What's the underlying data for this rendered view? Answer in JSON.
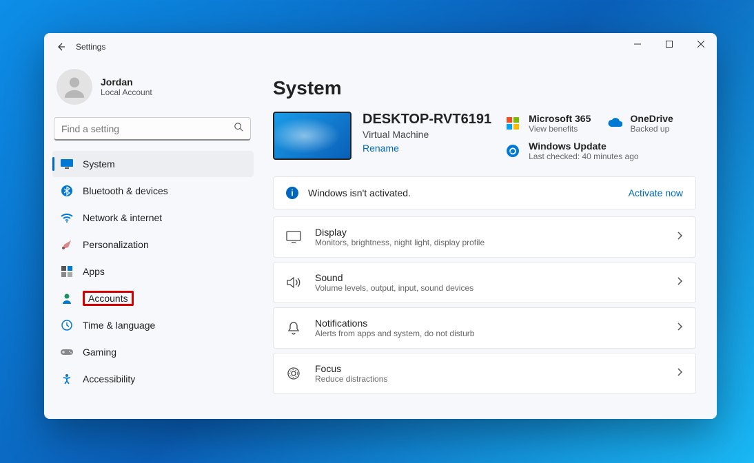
{
  "titlebar": {
    "title": "Settings"
  },
  "profile": {
    "name": "Jordan",
    "sub": "Local Account"
  },
  "search": {
    "placeholder": "Find a setting"
  },
  "nav": {
    "items": [
      {
        "label": "System",
        "icon": "monitor-icon",
        "active": true
      },
      {
        "label": "Bluetooth & devices",
        "icon": "bluetooth-icon"
      },
      {
        "label": "Network & internet",
        "icon": "wifi-icon"
      },
      {
        "label": "Personalization",
        "icon": "brush-icon"
      },
      {
        "label": "Apps",
        "icon": "apps-icon"
      },
      {
        "label": "Accounts",
        "icon": "person-icon",
        "highlight": true
      },
      {
        "label": "Time & language",
        "icon": "clock-icon"
      },
      {
        "label": "Gaming",
        "icon": "gamepad-icon"
      },
      {
        "label": "Accessibility",
        "icon": "accessibility-icon"
      }
    ]
  },
  "page": {
    "title": "System"
  },
  "pc": {
    "name": "DESKTOP-RVT6191",
    "type": "Virtual Machine",
    "rename": "Rename"
  },
  "cards": {
    "ms365": {
      "title": "Microsoft 365",
      "sub": "View benefits"
    },
    "onedrive": {
      "title": "OneDrive",
      "sub": "Backed up"
    },
    "update": {
      "title": "Windows Update",
      "sub": "Last checked: 40 minutes ago"
    }
  },
  "banner": {
    "text": "Windows isn't activated.",
    "action": "Activate now"
  },
  "rows": [
    {
      "title": "Display",
      "sub": "Monitors, brightness, night light, display profile",
      "icon": "display-icon"
    },
    {
      "title": "Sound",
      "sub": "Volume levels, output, input, sound devices",
      "icon": "sound-icon"
    },
    {
      "title": "Notifications",
      "sub": "Alerts from apps and system, do not disturb",
      "icon": "bell-icon"
    },
    {
      "title": "Focus",
      "sub": "Reduce distractions",
      "icon": "focus-icon"
    }
  ]
}
